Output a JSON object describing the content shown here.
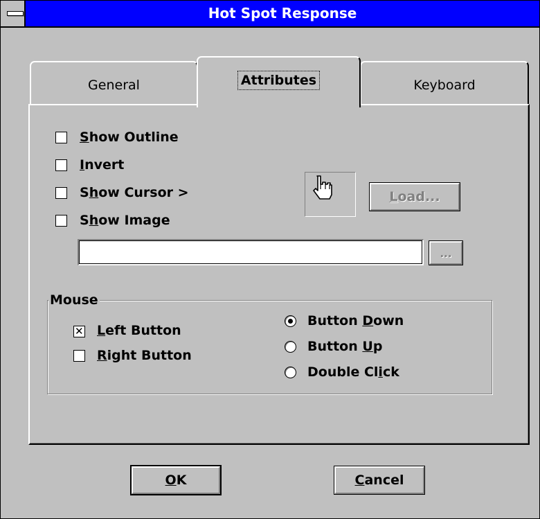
{
  "window": {
    "title": "Hot Spot Response"
  },
  "tabs": [
    {
      "label": "General",
      "active": false
    },
    {
      "label": "Attributes",
      "active": true
    },
    {
      "label": "Keyboard",
      "active": false
    }
  ],
  "attributes": {
    "checkboxes": [
      {
        "pre": "",
        "mn": "S",
        "post": "how Outline",
        "checked": false
      },
      {
        "pre": "",
        "mn": "I",
        "post": "nvert",
        "checked": false
      },
      {
        "pre": "S",
        "mn": "h",
        "post": "ow Cursor >",
        "checked": false
      },
      {
        "pre": "S",
        "mn": "h",
        "post": "ow Image",
        "checked": false
      }
    ],
    "cursor_preview_icon": "hand-pointer-icon",
    "load_button": {
      "mn": "L",
      "post": "oad...",
      "enabled": false
    },
    "image_path": {
      "value": ""
    },
    "browse_button": {
      "label": "...",
      "enabled": false
    }
  },
  "mouse": {
    "group_title": "Mouse",
    "buttons": [
      {
        "pre": "",
        "mn": "L",
        "post": "eft Button",
        "checked": true
      },
      {
        "pre": "",
        "mn": "R",
        "post": "ight Button",
        "checked": false
      }
    ],
    "actions": [
      {
        "pre": "Button ",
        "mn": "D",
        "post": "own",
        "selected": true
      },
      {
        "pre": "Button ",
        "mn": "U",
        "post": "p",
        "selected": false
      },
      {
        "pre": "Double Cl",
        "mn": "i",
        "post": "ck",
        "selected": false
      }
    ]
  },
  "footer": {
    "ok": {
      "pre": "",
      "mn": "O",
      "post": "K"
    },
    "cancel": {
      "pre": "",
      "mn": "C",
      "post": "ancel"
    }
  }
}
